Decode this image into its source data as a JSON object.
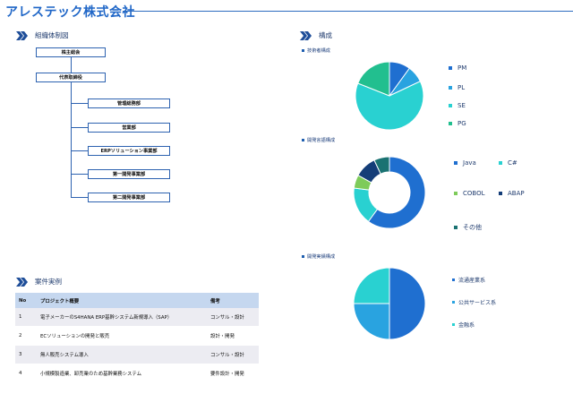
{
  "header": {
    "title": "アレステック株式会社"
  },
  "org": {
    "heading": "組織体制図",
    "shareholders": "株主総会",
    "ceo": "代表取締役",
    "departments": [
      "管理総務部",
      "営業部",
      "ERPソリューション事業部",
      "第一開発事業部",
      "第二開発事業部"
    ]
  },
  "composition": {
    "heading": "構成",
    "charts": [
      {
        "label": "技術者構成"
      },
      {
        "label": "開発言語構成"
      },
      {
        "label": "開発実績構成"
      }
    ]
  },
  "chart_data": [
    {
      "type": "pie",
      "title": "技術者構成",
      "categories": [
        "PM",
        "PL",
        "SE",
        "PG"
      ],
      "values": [
        10,
        8,
        63,
        19
      ],
      "colors": [
        "#1f6fd0",
        "#29a3e0",
        "#29d1d1",
        "#22bf8f"
      ],
      "legend": "right"
    },
    {
      "type": "pie",
      "title": "開発言語構成",
      "categories": [
        "Java",
        "C#",
        "COBOL",
        "ABAP",
        "その他"
      ],
      "values": [
        60,
        17,
        6,
        10,
        7
      ],
      "colors": [
        "#1f6fd0",
        "#29d1d1",
        "#7ecb5a",
        "#143d78",
        "#1a7272"
      ],
      "donut": true,
      "legend": "right"
    },
    {
      "type": "pie",
      "title": "開発実績構成",
      "categories": [
        "流通産業系",
        "公共サービス系",
        "金融系"
      ],
      "values": [
        50,
        25,
        25
      ],
      "colors": [
        "#1f6fd0",
        "#29a3e0",
        "#29d1d1"
      ],
      "legend": "right"
    }
  ],
  "cases": {
    "heading": "案件実例",
    "columns": [
      "No",
      "プロジェクト概要",
      "備考"
    ],
    "rows": [
      [
        "1",
        "電子メーカーのS4HANA ERP基幹システム新規導入（SAP）",
        "コンサル・設計"
      ],
      [
        "2",
        "ECソリューションの開発と販売",
        "設計・開発"
      ],
      [
        "3",
        "無人販売システム導入",
        "コンサル・設計"
      ],
      [
        "4",
        "小規模製造業、卸売業のため基幹業務システム",
        "要件設計・開発"
      ]
    ]
  },
  "icons": {
    "section_marker": "double-chevron-right-icon"
  }
}
